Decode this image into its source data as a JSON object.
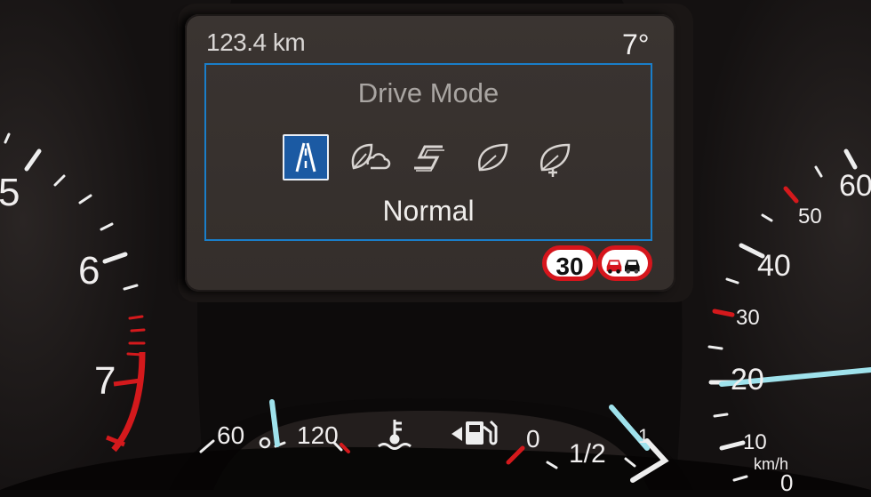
{
  "display": {
    "trip_distance": "123.4 km",
    "outside_temp": "7°",
    "panel": {
      "title": "Drive Mode",
      "selected_mode": "Normal",
      "modes": [
        {
          "icon": "normal-road-icon",
          "selected": true
        },
        {
          "icon": "slippery-cloud-leaf-icon",
          "selected": false
        },
        {
          "icon": "sport-s-icon",
          "selected": false
        },
        {
          "icon": "eco-leaf-icon",
          "selected": false
        },
        {
          "icon": "eco-plus-leaf-icon",
          "selected": false
        }
      ],
      "accent_color": "#1a7ec9"
    },
    "traffic_signs": {
      "speed_limit": "30",
      "no_overtaking_icon": "no-overtaking-icon",
      "ring_color": "#d6151c"
    }
  },
  "tachometer": {
    "labels": [
      "5",
      "6",
      "7"
    ]
  },
  "speedometer": {
    "labels": [
      "60",
      "50",
      "40",
      "30",
      "20",
      "10",
      "0"
    ],
    "unit": "km/h"
  },
  "lower_gauges": {
    "temp_labels": [
      "60",
      "120"
    ],
    "fuel_labels": [
      "0",
      "1/2",
      "1"
    ],
    "icons": [
      "coolant-temperature-icon",
      "fuel-pump-icon"
    ]
  }
}
